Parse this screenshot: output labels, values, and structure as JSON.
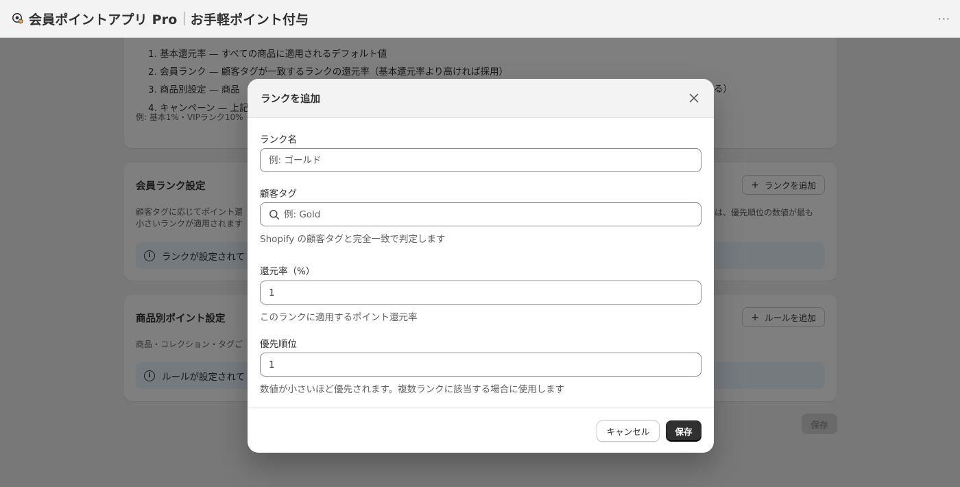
{
  "header": {
    "app_name": "会員ポイントアプリ Pro",
    "page_name": "お手軽ポイント付与",
    "more_label": "···"
  },
  "priority_section": {
    "items": [
      "1. 基本還元率 — すべての商品に適用されるデフォルト値",
      "2. 会員ランク — 顧客タグが一致するランクの還元率（基本還元率より高ければ採用）",
      "3. 商品別設定 — 商品",
      "4. キャンペーン — 上記"
    ],
    "trailing_text": "る）",
    "example": "例: 基本1%・VIPランク10%"
  },
  "rank_section": {
    "title": "会員ランク設定",
    "add_button": "ランクを追加",
    "description_line1": "顧客タグに応じてポイント還",
    "description_tail": "は、優先順位の数値が最も",
    "description_line2": "小さいランクが適用されます",
    "empty_banner": "ランクが設定されて"
  },
  "product_section": {
    "title": "商品別ポイント設定",
    "add_button": "ルールを追加",
    "description": "商品・コレクション・タグご",
    "empty_banner": "ルールが設定されて"
  },
  "page_save_button": "保存",
  "modal": {
    "title": "ランクを追加",
    "rank_name": {
      "label": "ランク名",
      "placeholder": "例: ゴールド",
      "value": ""
    },
    "customer_tag": {
      "label": "顧客タグ",
      "placeholder": "例: Gold",
      "value": "",
      "help": "Shopify の顧客タグと完全一致で判定します"
    },
    "rate": {
      "label": "還元率（%）",
      "value": "1",
      "help": "このランクに適用するポイント還元率"
    },
    "priority": {
      "label": "優先順位",
      "value": "1",
      "help": "数値が小さいほど優先されます。複数ランクに該当する場合に使用します"
    },
    "cancel_button": "キャンセル",
    "save_button": "保存"
  }
}
